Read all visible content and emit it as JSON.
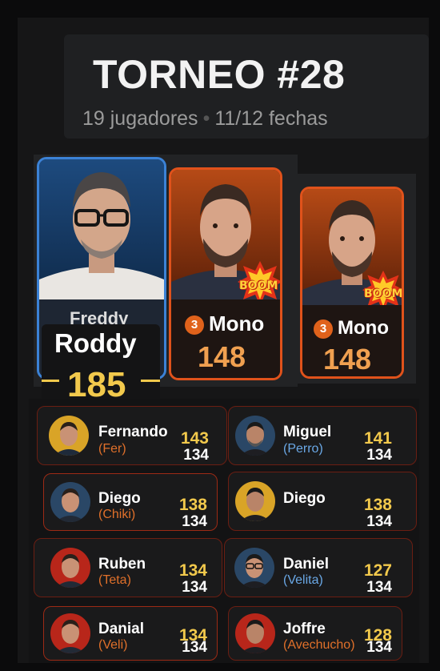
{
  "header": {
    "title": "TORNEO #28",
    "players": "19 jugadores",
    "dates": "11/12 fechas"
  },
  "podium": [
    {
      "name_top": "Freddy",
      "name": "Roddy",
      "score": "185",
      "rank": ""
    },
    {
      "name": "Mono",
      "score": "148",
      "rank": "3",
      "sticker": "BOOM"
    },
    {
      "name": "Mono",
      "score": "148",
      "rank": "3",
      "sticker": "BOOM"
    }
  ],
  "rows": [
    {
      "name": "Fernando",
      "nick": "(Fer)",
      "score": "143",
      "prev": "134"
    },
    {
      "name": "Miguel",
      "nick": "(Perro)",
      "score": "141",
      "prev": "134"
    },
    {
      "name": "Diego",
      "nick": "(Chiki)",
      "score": "138",
      "prev": "134"
    },
    {
      "name": "Diego",
      "nick": "",
      "score": "138",
      "prev": "134"
    },
    {
      "name": "Ruben",
      "nick": "(Teta)",
      "score": "134",
      "prev": "134"
    },
    {
      "name": "Daniel",
      "nick": "(Velita)",
      "score": "127",
      "prev": "134"
    },
    {
      "name": "Danial",
      "nick": "(Veli)",
      "score": "134",
      "prev": "134"
    },
    {
      "name": "Joffre",
      "nick": "(Avechucho)",
      "score": "128",
      "prev": "134"
    }
  ],
  "colors": {
    "gold": "#f2c94c",
    "orange": "#e0521b",
    "blue": "#3b82d6"
  }
}
